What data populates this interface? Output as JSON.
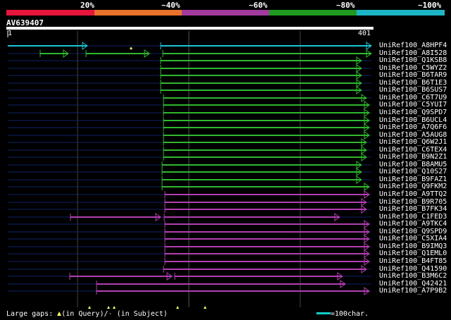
{
  "legend": {
    "colors": [
      "#e8153c",
      "#e8732b",
      "#a23a9e",
      "#1f9a1f",
      "#1cb5c5"
    ],
    "labels": [
      "20%",
      "~40%",
      "~60%",
      "~80%",
      "~100%"
    ]
  },
  "query": {
    "name": "AV639407",
    "start": "1",
    "end": "401"
  },
  "hits": [
    {
      "name": "UniRef100_A8HPF4",
      "color": "#1cc4d4"
    },
    {
      "name": "UniRef100_A8I528",
      "color": "#2fb82f"
    },
    {
      "name": "UniRef100_Q1KSB8",
      "color": "#2fb82f"
    },
    {
      "name": "UniRef100_C5WYZ2",
      "color": "#2fb82f"
    },
    {
      "name": "UniRef100_B6TAR9",
      "color": "#2fb82f"
    },
    {
      "name": "UniRef100_B6T1E3",
      "color": "#2fb82f"
    },
    {
      "name": "UniRef100_B6SUS7",
      "color": "#2fb82f"
    },
    {
      "name": "UniRef100_C6T7U9",
      "color": "#2fb82f"
    },
    {
      "name": "UniRef100_C5YUI7",
      "color": "#2fb82f"
    },
    {
      "name": "UniRef100_Q9SPD7",
      "color": "#2fb82f"
    },
    {
      "name": "UniRef100_B6UCL4",
      "color": "#2fb82f"
    },
    {
      "name": "UniRef100_A7Q6F6",
      "color": "#2fb82f"
    },
    {
      "name": "UniRef100_A5AUG8",
      "color": "#2fb82f"
    },
    {
      "name": "UniRef100_Q6W2J1",
      "color": "#2fb82f"
    },
    {
      "name": "UniRef100_C6TEX4",
      "color": "#2fb82f"
    },
    {
      "name": "UniRef100_B9N2Z1",
      "color": "#2fb82f"
    },
    {
      "name": "UniRef100_B8AMU5",
      "color": "#2fb82f"
    },
    {
      "name": "UniRef100_Q10S27",
      "color": "#2fb82f"
    },
    {
      "name": "UniRef100_B9FAZ1",
      "color": "#2fb82f"
    },
    {
      "name": "UniRef100_Q9FKM2",
      "color": "#2fb82f"
    },
    {
      "name": "UniRef100_A9TTQ2",
      "color": "#b23fb2"
    },
    {
      "name": "UniRef100_B9R705",
      "color": "#b23fb2"
    },
    {
      "name": "UniRef100_B7FK34",
      "color": "#b23fb2"
    },
    {
      "name": "UniRef100_C1FED3",
      "color": "#b23fb2"
    },
    {
      "name": "UniRef100_A9TKC4",
      "color": "#b23fb2"
    },
    {
      "name": "UniRef100_Q9SPD9",
      "color": "#b23fb2"
    },
    {
      "name": "UniRef100_C5XIA4",
      "color": "#b23fb2"
    },
    {
      "name": "UniRef100_B9IMQ3",
      "color": "#b23fb2"
    },
    {
      "name": "UniRef100_Q1EML0",
      "color": "#b23fb2"
    },
    {
      "name": "UniRef100_B4FT85",
      "color": "#b23fb2"
    },
    {
      "name": "UniRef100_Q41590",
      "color": "#b23fb2"
    },
    {
      "name": "UniRef100_B3M6C2",
      "color": "#b23fb2"
    },
    {
      "name": "UniRef100_Q42421",
      "color": "#b23fb2"
    },
    {
      "name": "UniRef100_A7P9B2",
      "color": "#b23fb2"
    }
  ],
  "footer": {
    "gaps_label": "Large gaps:",
    "in_query": "(in Query)/",
    "in_subject": "(in Subject)",
    "scale_label": "=100char."
  }
}
